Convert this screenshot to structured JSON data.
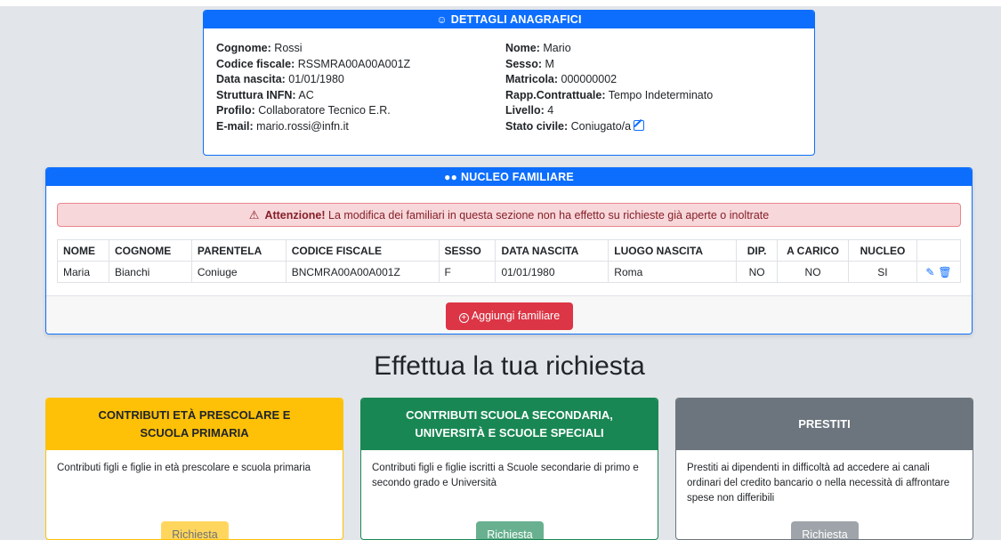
{
  "anagrafica": {
    "header": "DETTAGLI ANAGRAFICI",
    "left": [
      {
        "label": "Cognome:",
        "value": "Rossi"
      },
      {
        "label": "Codice fiscale:",
        "value": "RSSMRA00A00A001Z"
      },
      {
        "label": "Data nascita:",
        "value": "01/01/1980"
      },
      {
        "label": "Struttura INFN:",
        "value": "AC"
      },
      {
        "label": "Profilo:",
        "value": "Collaboratore Tecnico E.R."
      },
      {
        "label": "E-mail:",
        "value": "mario.rossi@infn.it"
      }
    ],
    "right": [
      {
        "label": "Nome:",
        "value": "Mario"
      },
      {
        "label": "Sesso:",
        "value": "M"
      },
      {
        "label": "Matricola:",
        "value": "000000002"
      },
      {
        "label": "Rapp.Contrattuale:",
        "value": "Tempo Indeterminato"
      },
      {
        "label": "Livello:",
        "value": "4"
      },
      {
        "label": "Stato civile:",
        "value": "Coniugato/a"
      }
    ]
  },
  "nucleo": {
    "header": "NUCLEO FAMILIARE",
    "alert_strong": "Attenzione!",
    "alert_text": "La modifica dei familiari in questa sezione non ha effetto su richieste già aperte o inoltrate",
    "columns": [
      "NOME",
      "COGNOME",
      "PARENTELA",
      "CODICE FISCALE",
      "SESSO",
      "DATA NASCITA",
      "LUOGO NASCITA",
      "DIP.",
      "A CARICO",
      "NUCLEO"
    ],
    "rows": [
      {
        "nome": "Maria",
        "cognome": "Bianchi",
        "parentela": "Coniuge",
        "codice_fiscale": "BNCMRA00A00A001Z",
        "sesso": "F",
        "data_nascita": "01/01/1980",
        "luogo_nascita": "Roma",
        "dip": "NO",
        "a_carico": "NO",
        "nucleo": "SI"
      }
    ],
    "add_button": "Aggiungi familiare"
  },
  "section_title": "Effettua la tua richiesta",
  "cards": [
    {
      "title": "CONTRIBUTI ETÀ PRESCOLARE E SCUOLA PRIMARIA",
      "text": "Contributi figli e figlie in età prescolare e scuola primaria",
      "button": "Richiesta",
      "color": "#ffc107"
    },
    {
      "title": "CONTRIBUTI SCUOLA SECONDARIA, UNIVERSITÀ E SCUOLE SPECIALI",
      "text": "Contributi figli e figlie iscritti a Scuole secondarie di primo e secondo grado e Università",
      "button": "Richiesta",
      "color": "#198754"
    },
    {
      "title": "PRESTITI",
      "text": "Prestiti ai dipendenti in difficoltà ad accedere ai canali ordinari del credito bancario o nella necessità di affrontare spese non differibili",
      "button": "Richiesta",
      "color": "#6c757d"
    }
  ]
}
